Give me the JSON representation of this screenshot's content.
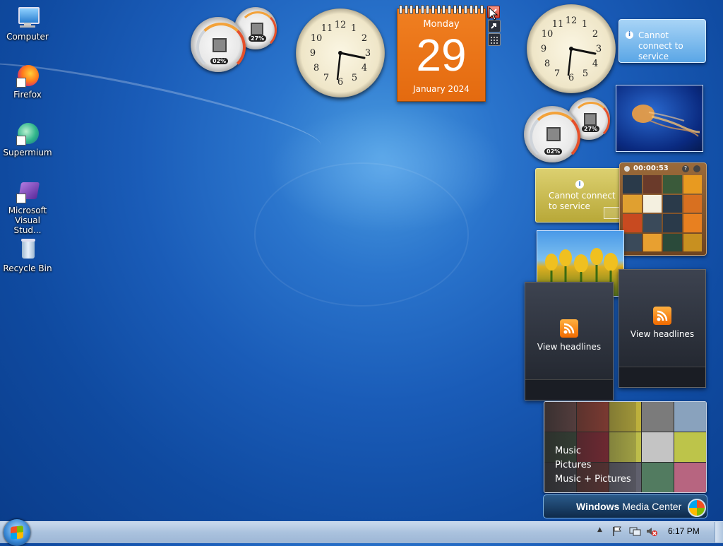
{
  "desktop_icons": [
    {
      "label": "Computer",
      "icon": "computer-icon"
    },
    {
      "label": "Firefox",
      "icon": "firefox-icon"
    },
    {
      "label": "Supermium",
      "icon": "supermium-icon"
    },
    {
      "label": "Microsoft Visual Stud...",
      "icon": "visual-studio-icon"
    },
    {
      "label": "Recycle Bin",
      "icon": "recycle-bin-icon"
    }
  ],
  "calendar": {
    "weekday": "Monday",
    "day": "29",
    "month_year": "January 2024"
  },
  "cpu_meter": {
    "cpu": "02%",
    "memory": "27%"
  },
  "cpu_meter_2": {
    "cpu": "02%",
    "memory": "27%"
  },
  "weather_top": {
    "message": "Cannot connect to service"
  },
  "currency": {
    "message": "Cannot connect to service"
  },
  "puzzle": {
    "timer": "00:00:53"
  },
  "feed_left": {
    "label": "View headlines"
  },
  "feed_right": {
    "label": "View headlines"
  },
  "media_center": {
    "items": [
      "Music",
      "Pictures",
      "Music + Pictures"
    ],
    "brand_bold": "Windows",
    "brand_light": "Media Center"
  },
  "taskbar": {
    "time": "6:17 PM"
  },
  "colors": {
    "calendar": "#e8701a",
    "taskbar": "#b3c9e3",
    "desktop": "#1a5cb8"
  }
}
